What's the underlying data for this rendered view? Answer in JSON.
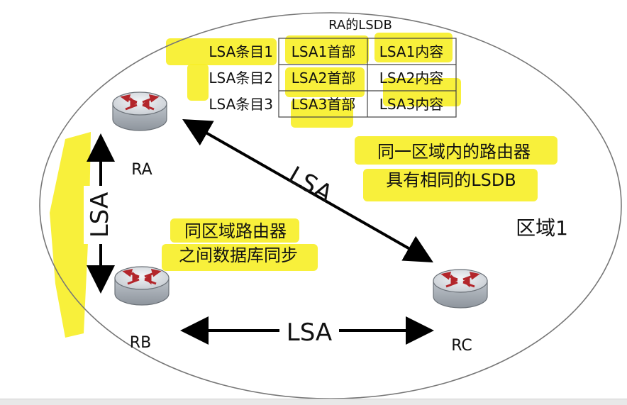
{
  "table": {
    "title": "RA的LSDB",
    "rows": [
      {
        "entry": "LSA条目1",
        "header": "LSA1首部",
        "content": "LSA1内容"
      },
      {
        "entry": "LSA条目2",
        "header": "LSA2首部",
        "content": "LSA2内容"
      },
      {
        "entry": "LSA条目3",
        "header": "LSA3首部",
        "content": "LSA3内容"
      }
    ]
  },
  "routers": {
    "ra": "RA",
    "rb": "RB",
    "rc": "RC"
  },
  "links": {
    "ra_rb": "LSA",
    "ra_rc": "LSA",
    "rb_rc": "LSA"
  },
  "notes": {
    "same_area_line1": "同一区域内的路由器",
    "same_area_line2": "具有相同的LSDB",
    "sync_line1": "同区域路由器",
    "sync_line2": "之间数据库同步"
  },
  "area_label": "区域1",
  "colors": {
    "highlight": "#f7ef2a",
    "router_body": "#d9dde2",
    "router_arrow": "#b3262b"
  },
  "icons": [
    "router-icon",
    "double-arrow-icon"
  ]
}
